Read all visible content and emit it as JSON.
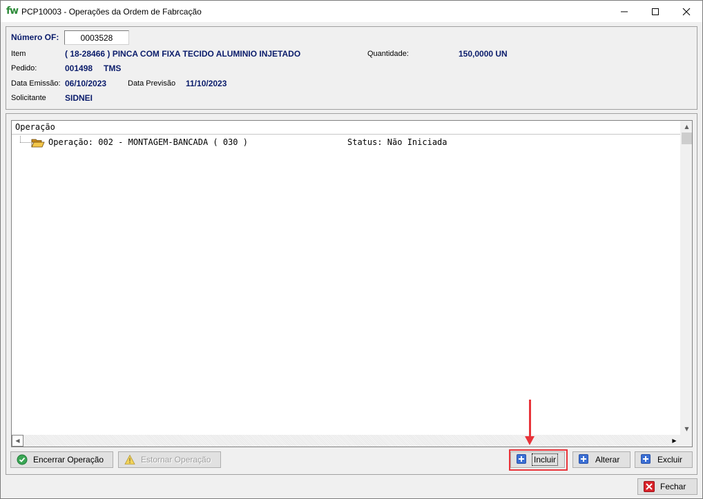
{
  "window": {
    "app_logo": "fw",
    "title": "PCP10003 - Operações da Ordem de Fabrcação",
    "minimize_glyph": "—",
    "maximize_glyph": "☐",
    "close_glyph": "✕"
  },
  "header": {
    "of_label": "Número OF:",
    "of_value": "0003528",
    "item_label": "Item",
    "item_value": "( 18-28466 ) PINCA COM FIXA TECIDO ALUMINIO INJETADO",
    "quantidade_label": "Quantidade:",
    "quantidade_value": "150,0000 UN",
    "pedido_label": "Pedido:",
    "pedido_value": "001498",
    "pedido_extra": "TMS",
    "data_emissao_label": "Data Emissão:",
    "data_emissao_value": "06/10/2023",
    "data_previsao_label": "Data Previsão",
    "data_previsao_value": "11/10/2023",
    "solicitante_label": "Solicitante",
    "solicitante_value": "SIDNEI"
  },
  "tree": {
    "column_header": "Operação",
    "rows": [
      {
        "operation": "Operação: 002 - MONTAGEM-BANCADA ( 030 )",
        "status": "Status: Não Iniciada"
      }
    ]
  },
  "buttons": {
    "encerrar": "Encerrar Operação",
    "estornar": "Estornar Operação",
    "incluir": "Incluir",
    "alterar": "Alterar",
    "excluir": "Excluir",
    "fechar": "Fechar"
  },
  "colors": {
    "value_text": "#0a1c6b",
    "highlight": "#e8343a",
    "button_icon_blue": "#3b6fd4",
    "ok_green": "#3aa655",
    "warning_yellow": "#f2c200",
    "close_red": "#d9232a"
  },
  "icons": {
    "tree_node": "open-folder-icon",
    "encerrar": "check-circle-icon",
    "estornar": "warning-icon",
    "incluir": "plus-icon",
    "alterar": "plus-icon",
    "excluir": "plus-icon",
    "fechar": "close-x-icon"
  }
}
